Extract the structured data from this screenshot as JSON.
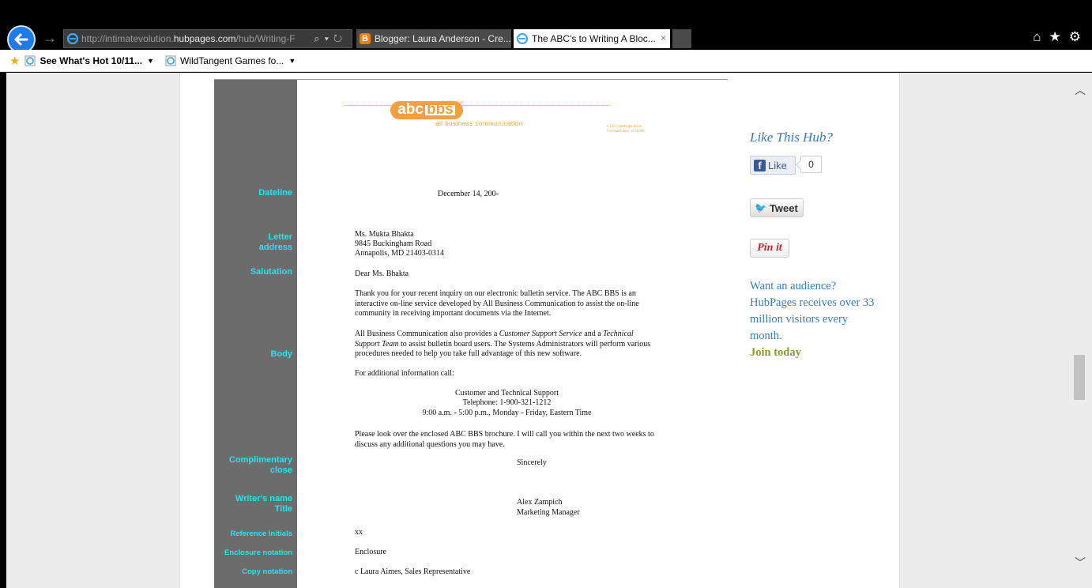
{
  "browser": {
    "address_prefix": "http://intimatevolution.",
    "address_domain": "hubpages.com",
    "address_rest": "/hub/Writing-F",
    "tabs": [
      {
        "label": "Blogger: Laura Anderson - Cre..."
      },
      {
        "label": "The ABC's to Writing A Bloc..."
      }
    ],
    "tab_close": "×",
    "favorites": [
      {
        "label": "See What's Hot 10/11..."
      },
      {
        "label": "WildTangent Games fo..."
      }
    ]
  },
  "letter": {
    "logo": {
      "abc": "abc",
      "bbs": "bbs",
      "subtitle": "all business communication",
      "phone": "▪ 515.555.0500",
      "address": "▪ 1955 partridge drive\n▪ orchard lane, at 50386"
    },
    "labels": {
      "dateline": "Dateline",
      "letter_address_1": "Letter",
      "letter_address_2": "address",
      "salutation": "Salutation",
      "body": "Body",
      "complimentary_1": "Complimentary",
      "complimentary_2": "close",
      "writer_1": "Writer's name",
      "writer_2": "Title",
      "reference": "Reference initials",
      "enclosure": "Enclosure notation",
      "copy": "Copy notation"
    },
    "date": "December 14, 200-",
    "address_lines": [
      "Ms. Mukta Bhakta",
      "9845 Buckingham Road",
      "Annapolis, MD  21403-0314"
    ],
    "salutation": "Dear Ms. Bhakta",
    "para1": "Thank you for your recent inquiry on our electronic bulletin service.  The ABC BBS is an interactive on-line service developed by All Business Communication to assist the on-line community in receiving important documents via the Internet.",
    "para2_a": "All Business Communication also provides a ",
    "para2_i1": "Customer Support Service",
    "para2_b": " and a ",
    "para2_i2": "Technical Support Team",
    "para2_c": " to assist bulletin board users.  The Systems Administrators will perform various procedures needed to help you take full advantage of this new software.",
    "para3": "For additional information call:",
    "support_lines": [
      "Customer and Technical Support",
      "Telephone: 1-900-321-1212",
      "9:00 a.m. - 5:00 p.m., Monday - Friday, Eastern Time"
    ],
    "para4": "Please look over the enclosed ABC BBS brochure.  I will call you within the next two weeks to discuss any additional questions you may have.",
    "close": "Sincerely",
    "writer_name": "Alex Zampich",
    "writer_title": "Marketing Manager",
    "initials": "xx",
    "enclosure": "Enclosure",
    "copy": "c Laura Aimes, Sales Representative"
  },
  "sidebar": {
    "like_heading": "Like This Hub?",
    "like_label": "Like",
    "like_count": "0",
    "tweet_label": "Tweet",
    "pinit_label": "Pin it",
    "audience_text": "Want an audience? HubPages receives over 33 million visitors every month.",
    "join_label": "Join today"
  },
  "colors": {
    "accent_blue": "#3a7bbf",
    "join_green": "#8a9a2a",
    "label_cyan": "#22e6ee",
    "logo_orange": "#f0a040"
  }
}
